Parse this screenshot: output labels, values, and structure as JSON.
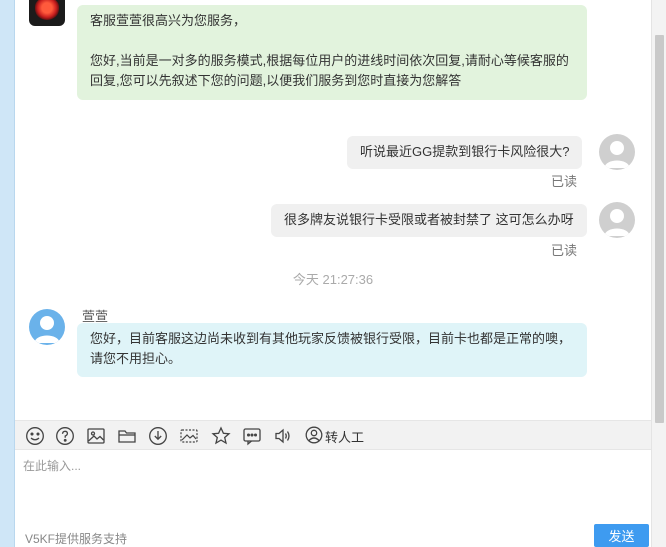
{
  "messages": {
    "agent_greeting": {
      "line1": "客服萱萱很高兴为您服务，",
      "line2": "您好,当前是一对多的服务模式,根据每位用户的进线时间依次回复,请耐心等候客服的",
      "line3": "回复,您可以先叙述下您的问题,以便我们服务到您时直接为您解答"
    },
    "user_msg_1": {
      "text": "听说最近GG提款到银行卡风险很大?",
      "status": "已读"
    },
    "user_msg_2": {
      "text": "很多牌友说银行卡受限或者被封禁了 这可怎么办呀",
      "status": "已读"
    },
    "timestamp": "今天 21:27:36",
    "agent_reply": {
      "sender": "萱萱",
      "line1": "您好，目前客服这边尚未收到有其他玩家反馈被银行受限，目前卡也都是正常的噢，",
      "line2": "请您不用担心。"
    }
  },
  "toolbar": {
    "icons": [
      "smile-icon",
      "help-icon",
      "image-icon",
      "folder-icon",
      "download-icon",
      "screenshot-icon",
      "star-icon",
      "message-icon",
      "voice-icon",
      "user-icon"
    ],
    "transfer_label": "转人工"
  },
  "input": {
    "placeholder": "在此输入..."
  },
  "footer": {
    "powered_by": "V5KF提供服务支持",
    "send_label": "发送"
  },
  "colors": {
    "send_button": "#3e9bf0",
    "agent_bubble_welcome": "#e2f3dd",
    "agent_bubble_reply": "#dff4f8",
    "user_bubble": "#f0f0f0"
  }
}
